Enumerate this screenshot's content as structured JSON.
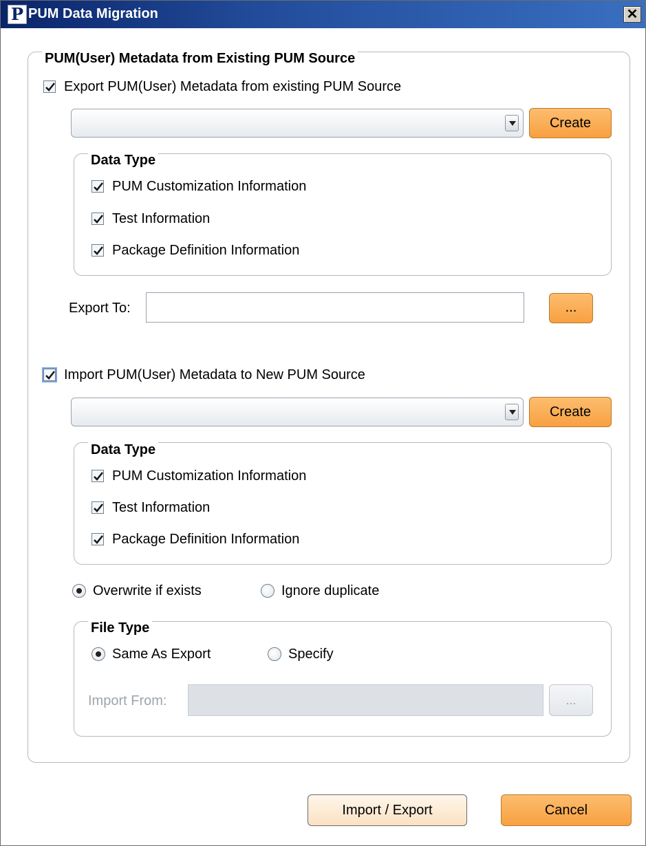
{
  "window": {
    "title": "PUM Data Migration",
    "app_icon_glyph": "P",
    "close_glyph": "✕"
  },
  "export_section": {
    "group_title": "PUM(User) Metadata from Existing PUM Source",
    "checkbox_label": "Export PUM(User) Metadata from existing PUM Source",
    "checked": true,
    "source_select_value": "",
    "create_label": "Create",
    "data_type": {
      "title": "Data Type",
      "items": [
        {
          "label": "PUM Customization Information",
          "checked": true
        },
        {
          "label": "Test Information",
          "checked": true
        },
        {
          "label": "Package Definition Information",
          "checked": true
        }
      ]
    },
    "export_to_label": "Export To:",
    "export_to_value": "",
    "browse_label": "..."
  },
  "import_section": {
    "checkbox_label": "Import PUM(User) Metadata to New PUM Source",
    "checked": true,
    "source_select_value": "",
    "create_label": "Create",
    "data_type": {
      "title": "Data Type",
      "items": [
        {
          "label": "PUM Customization Information",
          "checked": true
        },
        {
          "label": "Test Information",
          "checked": true
        },
        {
          "label": "Package Definition Information",
          "checked": true
        }
      ]
    },
    "duplicate_options": [
      {
        "label": "Overwrite if exists",
        "selected": true
      },
      {
        "label": "Ignore duplicate",
        "selected": false
      }
    ],
    "file_type": {
      "title": "File Type",
      "options": [
        {
          "label": "Same As Export",
          "selected": true
        },
        {
          "label": "Specify",
          "selected": false
        }
      ],
      "import_from_label": "Import From:",
      "import_from_value": "",
      "browse_label": "..."
    }
  },
  "footer": {
    "import_export_label": "Import / Export",
    "cancel_label": "Cancel"
  },
  "colors": {
    "title_bar": "#0a246a",
    "accent_orange": "#f8a041",
    "group_border": "#b9b9b9"
  }
}
